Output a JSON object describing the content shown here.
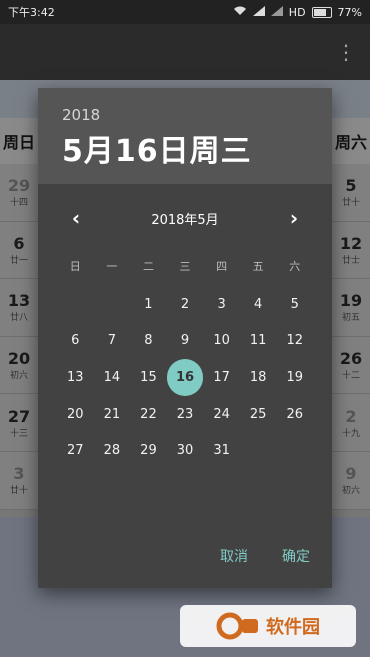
{
  "status_bar": {
    "time": "下午3:42",
    "network": "HD",
    "battery": "77%"
  },
  "background_calendar": {
    "left_header": "周日",
    "right_header": "周六",
    "left_col": [
      {
        "num": "29",
        "lunar": "十四",
        "dim": true
      },
      {
        "num": "6",
        "lunar": "廿一"
      },
      {
        "num": "13",
        "lunar": "廿八"
      },
      {
        "num": "20",
        "lunar": "初六"
      },
      {
        "num": "27",
        "lunar": "十三"
      },
      {
        "num": "3",
        "lunar": "廿十",
        "dim": true
      }
    ],
    "right_col": [
      {
        "num": "5",
        "lunar": "廿十"
      },
      {
        "num": "12",
        "lunar": "廿士"
      },
      {
        "num": "19",
        "lunar": "初五"
      },
      {
        "num": "26",
        "lunar": "十二"
      },
      {
        "num": "2",
        "lunar": "十九",
        "dim": true
      },
      {
        "num": "9",
        "lunar": "初六",
        "dim": true
      }
    ]
  },
  "dialog": {
    "year": "2018",
    "selected_date_label": "5月16日周三",
    "month_label": "2018年5月",
    "weekdays": [
      "日",
      "一",
      "二",
      "三",
      "四",
      "五",
      "六"
    ],
    "weeks": [
      [
        "",
        "",
        "",
        "1",
        "2",
        "3",
        "4",
        "5"
      ],
      [
        "6",
        "7",
        "8",
        "9",
        "10",
        "11",
        "12"
      ],
      [
        "13",
        "14",
        "15",
        "16",
        "17",
        "18",
        "19"
      ],
      [
        "20",
        "21",
        "22",
        "23",
        "24",
        "25",
        "26"
      ],
      [
        "27",
        "28",
        "29",
        "30",
        "31",
        "",
        ""
      ]
    ],
    "selected_day": "16",
    "cancel_label": "取消",
    "ok_label": "确定"
  },
  "watermark": {
    "text": "软件园"
  }
}
